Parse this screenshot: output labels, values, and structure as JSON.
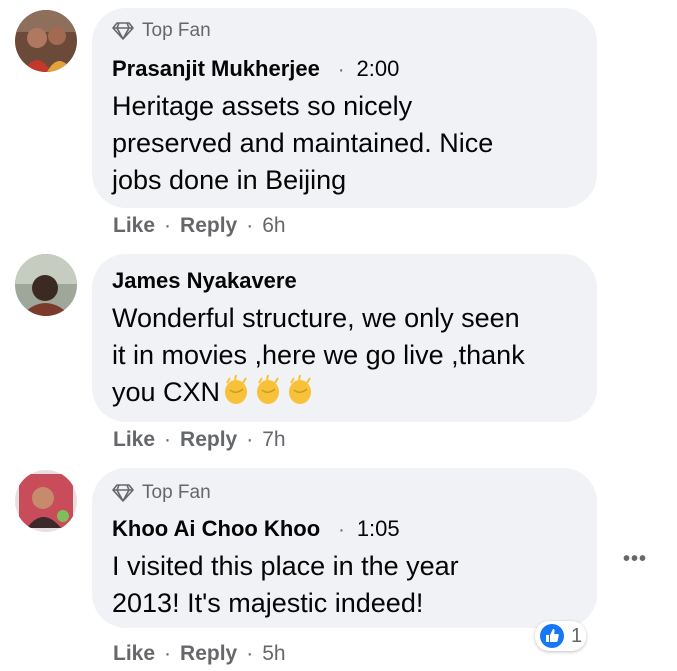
{
  "comments": [
    {
      "badge": "Top Fan",
      "name": "Prasanjit Mukherjee",
      "time": "2:00",
      "lines": [
        "Heritage assets so nicely",
        "preserved and maintained. Nice",
        "jobs done in Beijing"
      ],
      "like": "Like",
      "reply": "Reply",
      "age": "6h"
    },
    {
      "name": "James Nyakavere",
      "lines": [
        "Wonderful structure, we only seen",
        "it in movies ,here we go live ,thank",
        "you CXN"
      ],
      "like": "Like",
      "reply": "Reply",
      "age": "7h"
    },
    {
      "badge": "Top Fan",
      "name": "Khoo Ai Choo Khoo",
      "time": "1:05",
      "lines": [
        "I visited this place in the year",
        "2013! It's majestic indeed!"
      ],
      "like": "Like",
      "reply": "Reply",
      "age": "5h"
    }
  ],
  "separator": "·",
  "reaction_count": "1",
  "more_label": "•••",
  "colors": {
    "bubble": "#f0f2f5",
    "secondary_text": "#65676b",
    "like_blue": "#1877f2",
    "clap_yellow": "#f7c23a"
  },
  "icons": [
    "diamond-icon",
    "clapping-hands-emoji",
    "like-thumb-icon",
    "more-options-icon"
  ]
}
